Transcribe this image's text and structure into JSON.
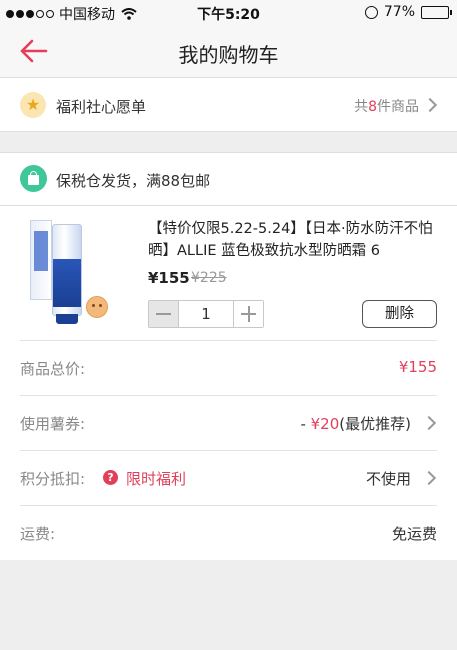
{
  "status_bar": {
    "carrier": "中国移动",
    "time": "下午5:20",
    "battery": "77%",
    "battery_level": 0.77
  },
  "nav": {
    "title": "我的购物车",
    "back_icon": "back-arrow-icon"
  },
  "wishlist": {
    "icon": "star-icon",
    "label": "福利社心愿单",
    "count_prefix": "共",
    "count": "8",
    "count_suffix": "件商品"
  },
  "shipping": {
    "icon": "shopping-bag-icon",
    "label": "保税仓发货，满88包邮"
  },
  "product": {
    "title": "【特价仅限5.22-5.24】【日本·防水防汗不怕晒】ALLIE 蓝色极致抗水型防晒霜 6",
    "price": "¥155",
    "old_price": "¥225",
    "quantity": "1",
    "delete_label": "删除"
  },
  "summary": {
    "total_label": "商品总价:",
    "total_value": "¥155",
    "coupon_label": "使用薯券:",
    "coupon_prefix": "- ",
    "coupon_amount": "¥20",
    "coupon_note": "(最优推荐)",
    "points_label": "积分抵扣:",
    "points_badge": "?",
    "points_promo": "限时福利",
    "points_value": "不使用",
    "shipping_fee_label": "运费:",
    "shipping_fee_value": "免运费"
  },
  "colors": {
    "accent": "#e2405a",
    "ship_icon_bg": "#3fc79a",
    "star_bg": "#fbe6b2"
  }
}
